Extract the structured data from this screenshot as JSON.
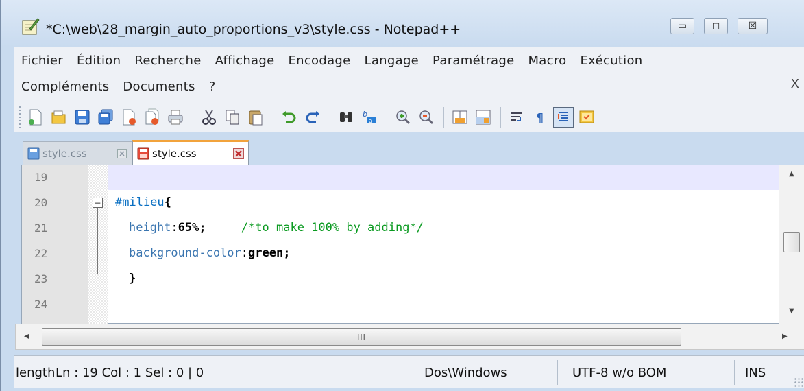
{
  "window": {
    "title": "*C:\\web\\28_margin_auto_proportions_v3\\style.css - Notepad++",
    "controls": {
      "minimize": "▭",
      "maximize": "◻",
      "close": "☒"
    }
  },
  "menu": {
    "row1": [
      "Fichier",
      "Édition",
      "Recherche",
      "Affichage",
      "Encodage",
      "Langage",
      "Paramétrage",
      "Macro",
      "Exécution"
    ],
    "row2": [
      "Compléments",
      "Documents",
      "?"
    ],
    "close": "X"
  },
  "toolbar": {
    "buttons": [
      "new-file-icon",
      "open-file-icon",
      "save-icon",
      "save-all-icon",
      "close-icon",
      "close-all-icon",
      "print-icon",
      "cut-icon",
      "copy-icon",
      "paste-icon",
      "undo-icon",
      "redo-icon",
      "find-icon",
      "replace-icon",
      "zoom-in-icon",
      "zoom-out-icon",
      "sync-vertical-icon",
      "sync-horizontal-icon",
      "word-wrap-icon",
      "show-all-chars-icon",
      "indent-guide-icon",
      "user-language-icon"
    ]
  },
  "tabs": [
    {
      "label": "style.css",
      "state": "inactive",
      "icon": "saved-file-icon"
    },
    {
      "label": "style.css",
      "state": "active",
      "icon": "unsaved-file-icon"
    }
  ],
  "editor": {
    "lines": [
      {
        "num": "19",
        "current": true,
        "tokens": []
      },
      {
        "num": "20",
        "tokens": [
          {
            "t": "sel",
            "v": "#milieu"
          },
          {
            "t": "brace",
            "v": "{"
          }
        ]
      },
      {
        "num": "21",
        "tokens": [
          {
            "t": "prop",
            "v": "height"
          },
          {
            "t": "colon",
            "v": ":"
          },
          {
            "t": "val",
            "v": "65%;"
          },
          {
            "t": "plain",
            "v": "     "
          },
          {
            "t": "comment",
            "v": "/*to make 100% by adding*/"
          }
        ]
      },
      {
        "num": "22",
        "tokens": [
          {
            "t": "prop",
            "v": "background-color"
          },
          {
            "t": "colon",
            "v": ":"
          },
          {
            "t": "val",
            "v": "green;"
          }
        ]
      },
      {
        "num": "23",
        "tokens": [
          {
            "t": "brace",
            "v": "}"
          }
        ]
      },
      {
        "num": "24",
        "tokens": []
      }
    ],
    "fold_marker": "−",
    "hscroll_grip": "III"
  },
  "status": {
    "length": "length",
    "position": "Ln : 19    Col : 1    Sel : 0 | 0",
    "eol": "Dos\\Windows",
    "encoding": "UTF-8 w/o BOM",
    "mode": "INS"
  },
  "colors": {
    "selector": "#0a6fc2",
    "property": "#3a75b0",
    "comment": "#0a9a20",
    "current_line": "#e8e8ff",
    "tab_accent": "#f2a33c"
  }
}
